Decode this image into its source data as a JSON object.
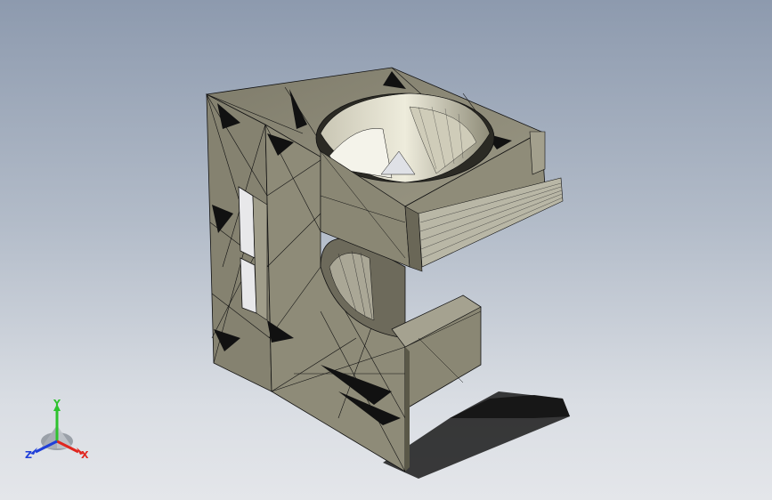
{
  "viewport": {
    "background_top": "#8d9aae",
    "background_bottom": "#e4e6ea",
    "model_color": "#8e8b78",
    "shadow_color": "#1a1a1a"
  },
  "triad": {
    "x_label": "X",
    "y_label": "Y",
    "z_label": "Z",
    "x_color": "#e0261f",
    "y_color": "#2ec22e",
    "z_color": "#1f3fd9"
  }
}
